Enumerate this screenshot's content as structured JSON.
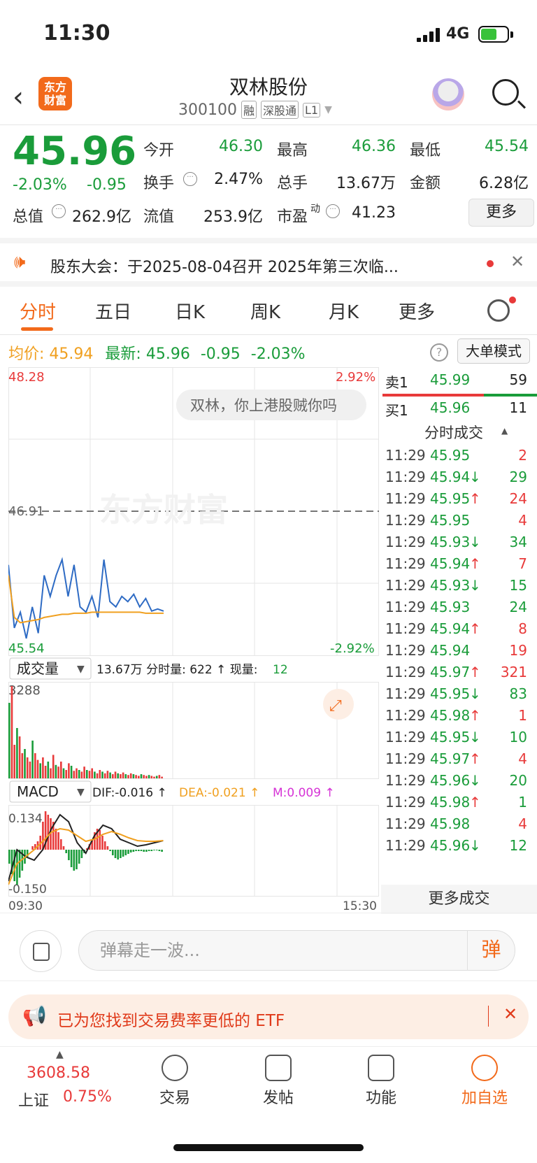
{
  "status": {
    "time": "11:30",
    "network": "4G"
  },
  "header": {
    "title": "双林股份",
    "code": "300100",
    "tags": [
      "融",
      "深股通",
      "L1"
    ]
  },
  "quote": {
    "price": "45.96",
    "change_pct": "-2.03%",
    "change": "-0.95",
    "fields": [
      {
        "label": "今开",
        "value": "46.30",
        "color": "#1a9c3a"
      },
      {
        "label": "最高",
        "value": "46.36",
        "color": "#1a9c3a"
      },
      {
        "label": "最低",
        "value": "45.54",
        "color": "#1a9c3a"
      },
      {
        "label": "换手",
        "value": "2.47%",
        "color": "#222"
      },
      {
        "label": "总手",
        "value": "13.67万",
        "color": "#222"
      },
      {
        "label": "金额",
        "value": "6.28亿",
        "color": "#222"
      },
      {
        "label": "总值",
        "value": "262.9亿",
        "color": "#222"
      },
      {
        "label": "流值",
        "value": "253.9亿",
        "color": "#222"
      },
      {
        "label": "市盈",
        "sup": "动",
        "value": "41.23",
        "color": "#222"
      }
    ],
    "more": "更多"
  },
  "notice": {
    "text": "股东大会：于2025-08-04召开 2025年第三次临..."
  },
  "tabs": [
    "分时",
    "五日",
    "日K",
    "周K",
    "月K",
    "更多"
  ],
  "avg": {
    "label": "均价:",
    "value": "45.94",
    "latest_label": "最新:",
    "latest": "45.96",
    "chg": "-0.95",
    "pct": "-2.03%",
    "mode": "大单模式"
  },
  "chart": {
    "y_top": "48.28",
    "y_mid": "46.91",
    "y_bot": "45.54",
    "pct_top": "2.92%",
    "pct_bot": "-2.92%",
    "comment": "双林，你上港股贼你吗",
    "watermark": "东方财富",
    "vol_label": "成交量",
    "vol_info": "13.67万 分时量: 622 ↑ 现量:",
    "vol_now": "12",
    "vol_max": "3288",
    "macd_label": "MACD",
    "dif": "DIF:-0.016 ↑",
    "dea": "DEA:-0.021 ↑",
    "m": "M:0.009 ↑",
    "macd_top": "0.134",
    "macd_bot": "-0.150",
    "t_start": "09:30",
    "t_end": "15:30"
  },
  "chart_data": {
    "type": "line",
    "series": [
      {
        "values": [
          46.4,
          45.8,
          45.95,
          45.7,
          46.0,
          45.75,
          46.3,
          46.1,
          46.3,
          46.45,
          46.1,
          46.4,
          46.0,
          45.95,
          46.1,
          45.9,
          46.45,
          46.05,
          46.0,
          46.1,
          46.05,
          46.12,
          46.0,
          46.08,
          45.96,
          45.98,
          45.96
        ]
      },
      {
        "values": [
          46.3,
          45.9,
          45.85,
          45.86,
          45.87,
          45.88,
          45.9,
          45.91,
          45.92,
          45.93,
          45.93,
          45.94,
          45.94,
          45.94,
          45.95,
          45.95,
          45.95,
          45.95,
          45.95,
          45.95,
          45.95,
          45.95,
          45.95,
          45.94,
          45.94,
          45.94,
          45.94
        ]
      }
    ],
    "ylim": [
      45.54,
      48.28
    ]
  },
  "orderbook": {
    "sell": {
      "label": "卖1",
      "price": "45.99",
      "vol": "59"
    },
    "buy": {
      "label": "买1",
      "price": "45.96",
      "vol": "11"
    },
    "title": "分时成交",
    "trades": [
      [
        "11:29",
        "45.95",
        "",
        "2",
        "r"
      ],
      [
        "11:29",
        "45.94",
        "↓",
        "29",
        "g"
      ],
      [
        "11:29",
        "45.95",
        "↑",
        "24",
        "r"
      ],
      [
        "11:29",
        "45.95",
        "",
        "4",
        "r"
      ],
      [
        "11:29",
        "45.93",
        "↓",
        "34",
        "g"
      ],
      [
        "11:29",
        "45.94",
        "↑",
        "7",
        "r"
      ],
      [
        "11:29",
        "45.93",
        "↓",
        "15",
        "g"
      ],
      [
        "11:29",
        "45.93",
        "",
        "24",
        "g"
      ],
      [
        "11:29",
        "45.94",
        "↑",
        "8",
        "r"
      ],
      [
        "11:29",
        "45.94",
        "",
        "19",
        "r"
      ],
      [
        "11:29",
        "45.97",
        "↑",
        "321",
        "r"
      ],
      [
        "11:29",
        "45.95",
        "↓",
        "83",
        "g"
      ],
      [
        "11:29",
        "45.98",
        "↑",
        "1",
        "r"
      ],
      [
        "11:29",
        "45.95",
        "↓",
        "10",
        "g"
      ],
      [
        "11:29",
        "45.97",
        "↑",
        "4",
        "r"
      ],
      [
        "11:29",
        "45.96",
        "↓",
        "20",
        "g"
      ],
      [
        "11:29",
        "45.98",
        "↑",
        "1",
        "g"
      ],
      [
        "11:29",
        "45.98",
        "",
        "4",
        "r"
      ],
      [
        "11:29",
        "45.96",
        "↓",
        "12",
        "g"
      ]
    ],
    "more": "更多成交"
  },
  "input": {
    "placeholder": "弹幕走一波...",
    "danmu": "弹"
  },
  "etf": {
    "text": "已为您找到交易费率更低的 ETF"
  },
  "nav": {
    "index_value": "3608.58",
    "index_name": "上证",
    "index_pct": "0.75%",
    "items": [
      "交易",
      "发帖",
      "功能",
      "加自选"
    ]
  }
}
